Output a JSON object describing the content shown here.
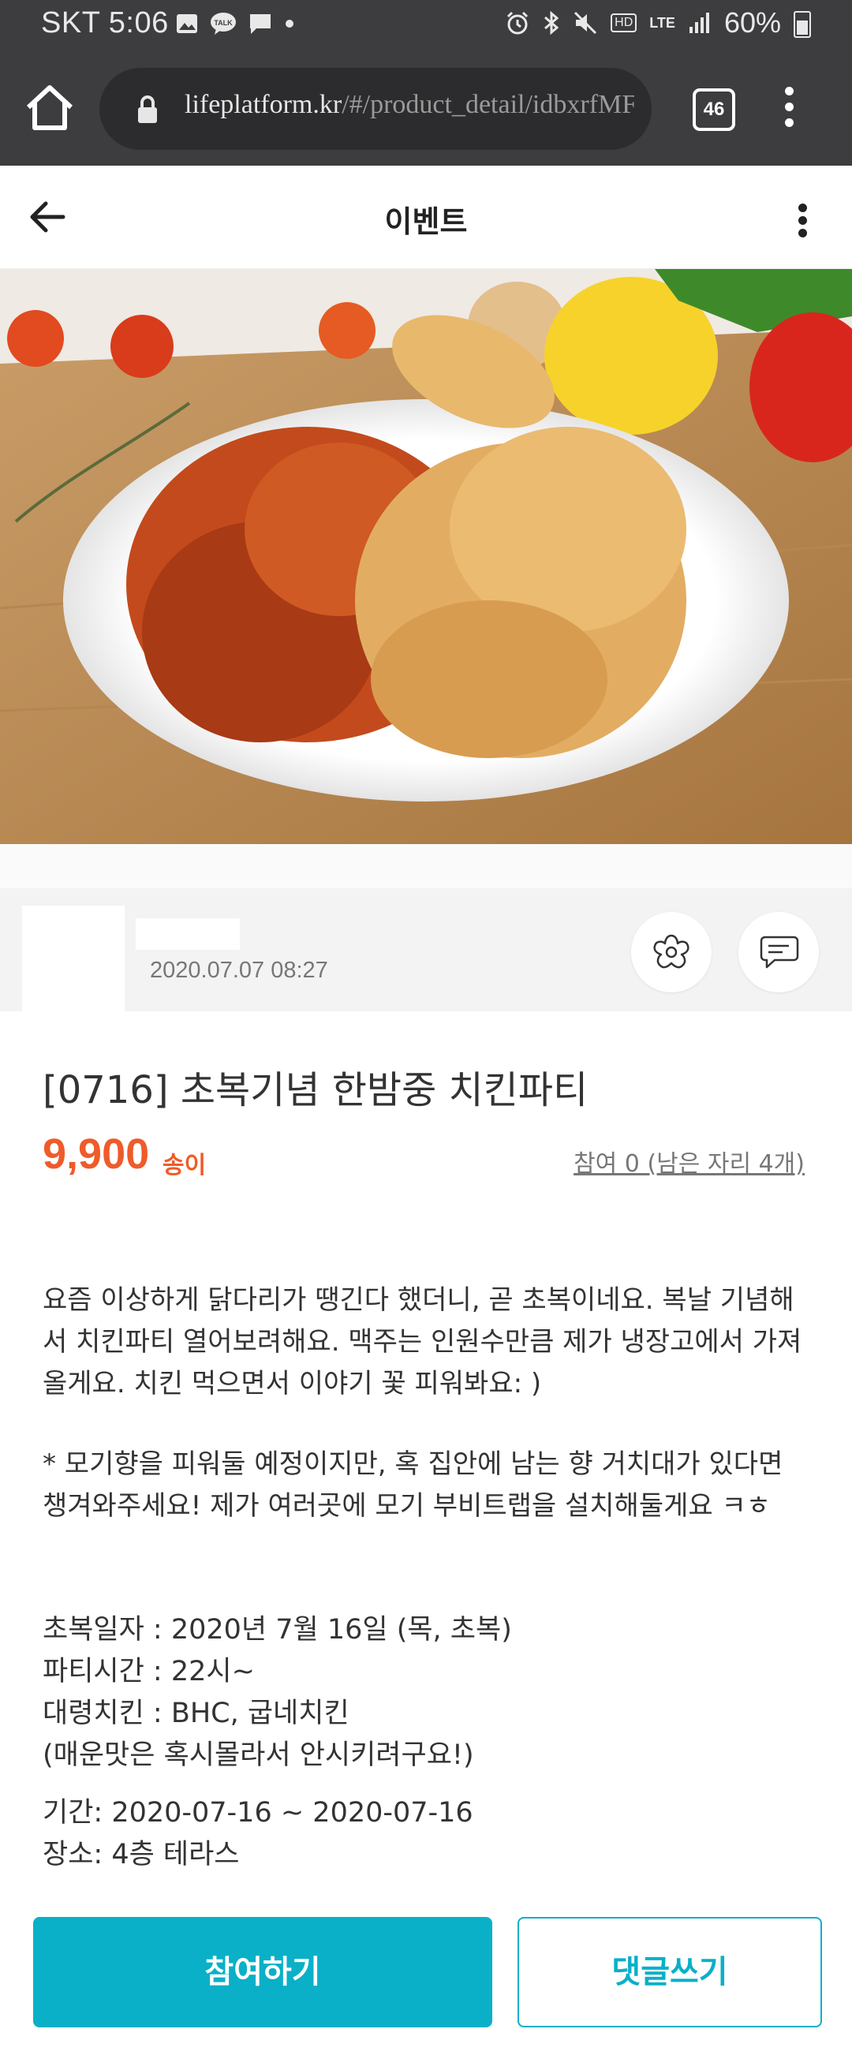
{
  "status_bar": {
    "carrier_time": "SKT 5:06",
    "network_hd": "HD",
    "network_lte": "LTE",
    "battery": "60%",
    "icons": [
      "gallery-icon",
      "talk-icon",
      "message-icon",
      "dot-icon",
      "alarm-icon",
      "bluetooth-icon",
      "mute-icon",
      "signal-icon",
      "battery-icon"
    ]
  },
  "browser": {
    "url_host": "lifeplatform.kr",
    "url_path": "/#/product_detail/idbxrfMF",
    "tab_count": "46"
  },
  "header": {
    "title": "이벤트"
  },
  "host": {
    "date": "2020.07.07 08:27"
  },
  "event": {
    "title": "[0716] 초복기념 한밤중 치킨파티",
    "price": "9,900",
    "price_unit": "송이",
    "participants": "참여 0 (남은 자리 4개)",
    "desc_1": "요즘 이상하게 닭다리가 땡긴다 했더니, 곧 초복이네요. 복날 기념해서 치킨파티 열어보려해요. 맥주는 인원수만큼 제가 냉장고에서 가져올게요. 치킨 먹으면서 이야기 꽃 피워봐요: )",
    "desc_2": "* 모기향을 피워둘 예정이지만, 혹 집안에 남는 향 거치대가 있다면 챙겨와주세요! 제가 여러곳에 모기 부비트랩을 설치해둘게요 ㅋㅎ",
    "details": [
      "초복일자 : 2020년 7월 16일 (목, 초복)",
      "파티시간 : 22시~",
      "대령치킨 : BHC, 굽네치킨",
      "(매운맛은 혹시몰라서 안시키려구요!)"
    ],
    "period": "기간: 2020-07-16 ~ 2020-07-16",
    "place": "장소: 4층 테라스"
  },
  "actions": {
    "join": "참여하기",
    "comment": "댓글쓰기"
  },
  "colors": {
    "accent": "#0ab0c8",
    "price": "#ef5b2a",
    "chrome": "#3d3d3f"
  }
}
